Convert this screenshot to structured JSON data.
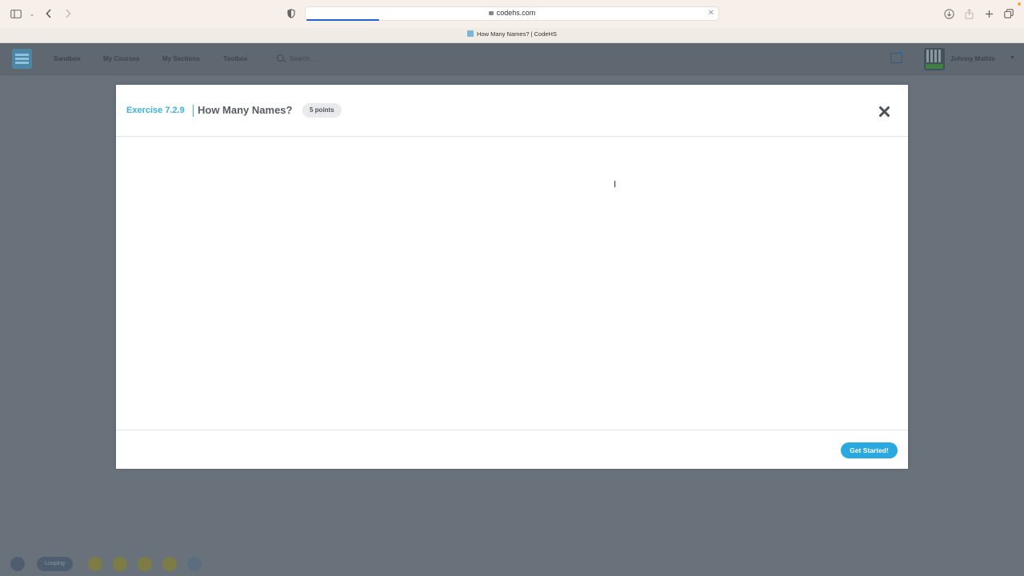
{
  "browser": {
    "url": "codehs.com",
    "tab_title": "How Many Names? | CodeHS",
    "sidebar_icon": "sidebar-icon",
    "back_icon": "chevron-left-icon",
    "forward_icon": "chevron-right-icon",
    "privacy_icon": "shield-icon",
    "download_icon": "download-icon",
    "share_icon": "share-icon",
    "new_tab_icon": "plus-icon",
    "tabs_icon": "tabs-overview-icon"
  },
  "site_header": {
    "nav": [
      "Sandbox",
      "My Courses",
      "My Sections",
      "Toolbox"
    ],
    "search_placeholder": "Search...",
    "user_name": "Johnny Mathis"
  },
  "bottom_bar": {
    "pill_label": "Looping"
  },
  "modal": {
    "exercise_label": "Exercise 7.2.9",
    "title": "How Many Names?",
    "points": "5 points",
    "cta_label": "Get Started!"
  },
  "colors": {
    "accent": "#3ab3de",
    "button": "#2aa8e0",
    "overlay": "#69727a"
  }
}
